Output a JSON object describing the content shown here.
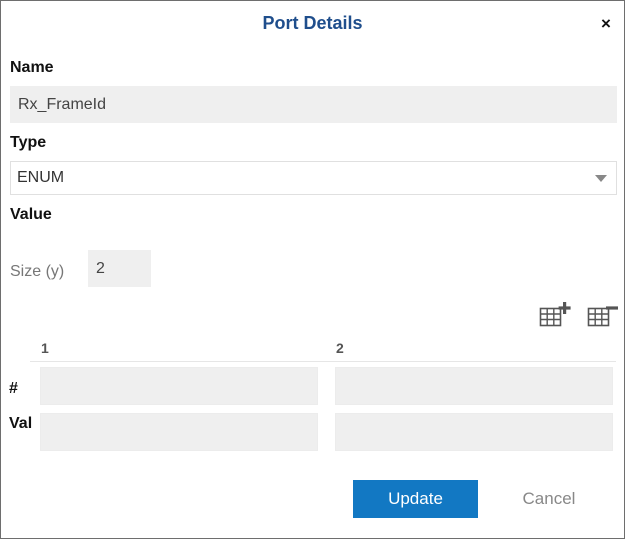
{
  "dialog": {
    "title": "Port Details",
    "close_label": "×"
  },
  "name": {
    "label": "Name",
    "value": "Rx_FrameId"
  },
  "type": {
    "label": "Type",
    "selected": "ENUM"
  },
  "value_section": {
    "label": "Value",
    "size_label": "Size (y)",
    "size_value": "2",
    "add_column_icon": "table-add-column-icon",
    "remove_column_icon": "table-remove-column-icon"
  },
  "table": {
    "columns": [
      "1",
      "2"
    ],
    "rows": [
      {
        "label": "#",
        "cells": [
          "",
          ""
        ]
      },
      {
        "label": "Val",
        "cells": [
          "",
          ""
        ]
      }
    ]
  },
  "buttons": {
    "update": "Update",
    "cancel": "Cancel"
  },
  "colors": {
    "title": "#1f4e8c",
    "primary_button": "#1278c3",
    "field_bg": "#efefef"
  }
}
